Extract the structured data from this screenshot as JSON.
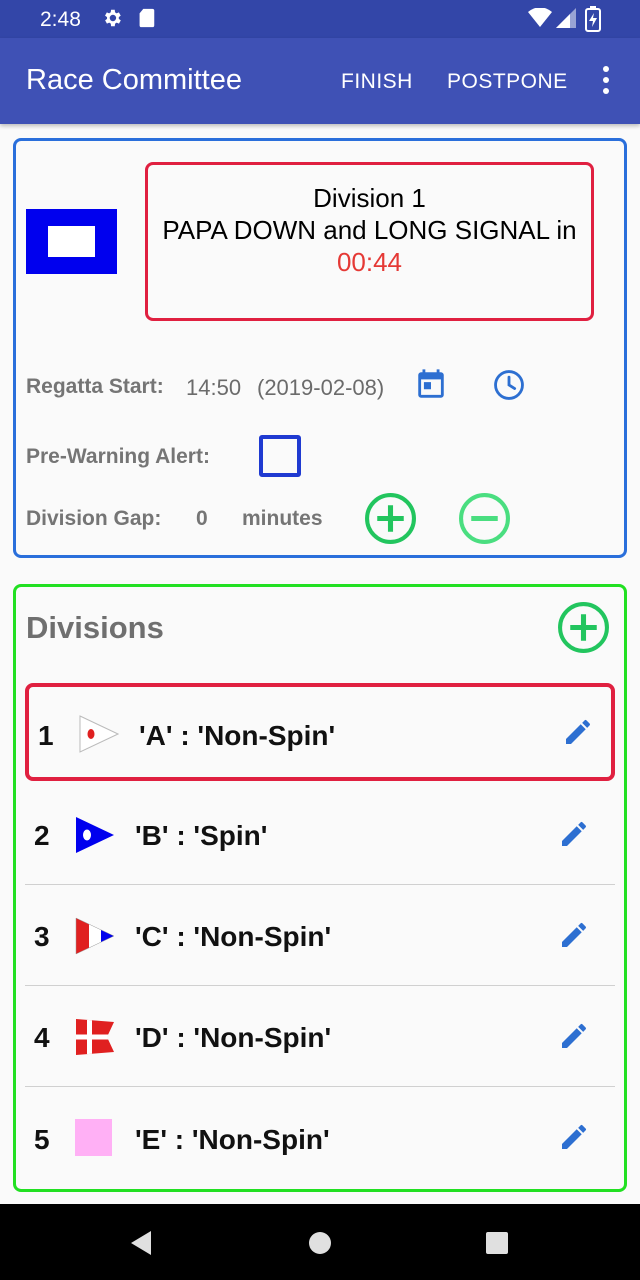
{
  "status_bar": {
    "time": "2:48"
  },
  "app_bar": {
    "title": "Race Committee",
    "finish_label": "FINISH",
    "postpone_label": "POSTPONE"
  },
  "sequence": {
    "division_label": "Division 1",
    "signal_text": "PAPA DOWN and LONG SIGNAL in",
    "countdown": "00:44",
    "regatta_start_label": "Regatta Start:",
    "start_time": "14:50",
    "start_date": "(2019-02-08)",
    "prewarning_label": "Pre-Warning Alert:",
    "division_gap_label": "Division Gap:",
    "division_gap_value": "0",
    "division_gap_unit": "minutes"
  },
  "divisions": {
    "heading": "Divisions",
    "items": [
      {
        "number": "1",
        "name": "'A' : 'Non-Spin'",
        "flag": "pennant-1-icon"
      },
      {
        "number": "2",
        "name": "'B' : 'Spin'",
        "flag": "pennant-2-icon"
      },
      {
        "number": "3",
        "name": "'C' : 'Non-Spin'",
        "flag": "pennant-3-icon"
      },
      {
        "number": "4",
        "name": "'D' : 'Non-Spin'",
        "flag": "pennant-4-icon"
      },
      {
        "number": "5",
        "name": "'E' : 'Non-Spin'",
        "flag": "pink-square-icon"
      }
    ]
  },
  "colors": {
    "primary": "#3f51b5",
    "accent_green": "#22c55e",
    "alert_red": "#e02040",
    "edit_blue": "#2d6fd1"
  }
}
